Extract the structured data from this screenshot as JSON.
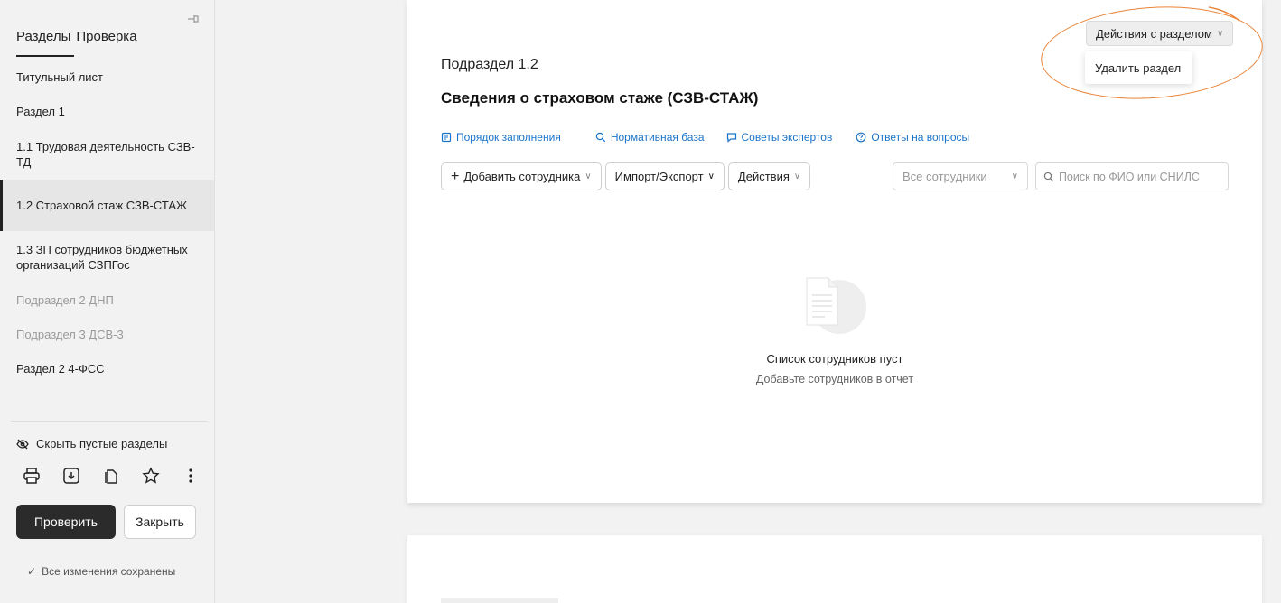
{
  "sidebar": {
    "tabs": [
      "Разделы",
      "Проверка"
    ],
    "items": [
      {
        "label": "Титульный лист",
        "state": "normal"
      },
      {
        "label": "Раздел 1",
        "state": "normal"
      },
      {
        "label": "1.1 Трудовая деятельность СЗВ-ТД",
        "state": "normal"
      },
      {
        "label": "1.2 Страховой стаж СЗВ-СТАЖ",
        "state": "active"
      },
      {
        "label": "1.3 ЗП сотрудников бюджетных организаций СЗПГос",
        "state": "normal"
      },
      {
        "label": "Подраздел 2 ДНП",
        "state": "muted"
      },
      {
        "label": "Подраздел 3 ДСВ-3",
        "state": "muted"
      },
      {
        "label": "Раздел 2 4-ФСС",
        "state": "normal"
      }
    ],
    "hide_empty_label": "Скрыть пустые разделы",
    "check_button": "Проверить",
    "close_button": "Закрыть",
    "saved_status": "Все изменения сохранены"
  },
  "main": {
    "subtitle": "Подраздел 1.2",
    "title": "Сведения о страховом стаже (СЗВ-СТАЖ)",
    "links": [
      {
        "label": "Порядок заполнения",
        "icon": "book-icon"
      },
      {
        "label": "Нормативная база",
        "icon": "search-icon"
      },
      {
        "label": "Советы экспертов",
        "icon": "chat-icon"
      },
      {
        "label": "Ответы на вопросы",
        "icon": "question-icon"
      }
    ],
    "add_employee": "Добавить сотрудника",
    "import_export": "Импорт/Экспорт",
    "actions": "Действия",
    "filter_value": "Все сотрудники",
    "search_placeholder": "Поиск по ФИО или СНИЛС",
    "section_actions": "Действия с разделом",
    "delete_section": "Удалить раздел",
    "empty_title": "Список сотрудников пуст",
    "empty_subtitle": "Добавьте сотрудников в отчет"
  },
  "colors": {
    "accent_link": "#1a73c8",
    "highlight_ellipse": "#e8843a",
    "primary_button": "#2b2b2b"
  }
}
